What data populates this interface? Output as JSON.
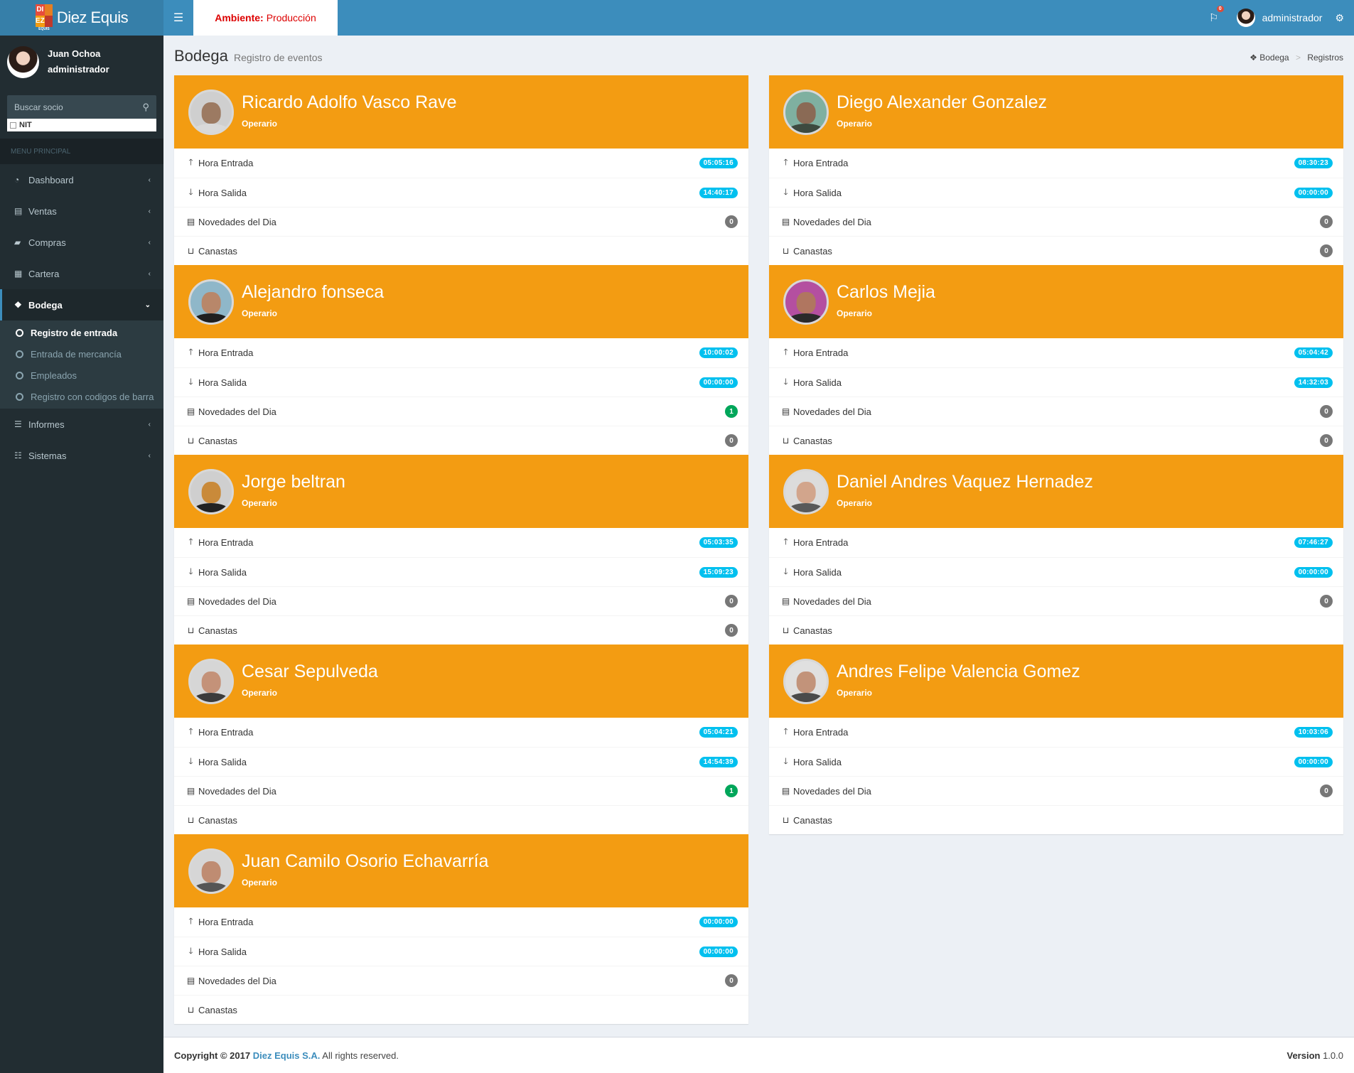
{
  "app": {
    "logo_letters": [
      "DI",
      "EZ"
    ],
    "logo_small": "EQUIS",
    "name": "Diez Equis"
  },
  "header": {
    "environment_label": "Ambiente:",
    "environment_value": "Producción",
    "notifications_count": "0",
    "user": "administrador"
  },
  "sidebar": {
    "user_name": "Juan Ochoa",
    "user_role": "administrador",
    "search_placeholder": "Buscar socio",
    "nit_label": "NIT",
    "menu_header": "MENU PRINCIPAL",
    "items": [
      {
        "label": "Dashboard",
        "icon": "dashboard-icon",
        "glyph": "◔"
      },
      {
        "label": "Ventas",
        "icon": "briefcase-icon",
        "glyph": "▤"
      },
      {
        "label": "Compras",
        "icon": "truck-icon",
        "glyph": "▰"
      },
      {
        "label": "Cartera",
        "icon": "calculator-icon",
        "glyph": "▦"
      },
      {
        "label": "Bodega",
        "icon": "cubes-icon",
        "glyph": "❖"
      },
      {
        "label": "Informes",
        "icon": "list-icon",
        "glyph": "☰"
      },
      {
        "label": "Sistemas",
        "icon": "sliders-icon",
        "glyph": "☷"
      }
    ],
    "submenu": [
      {
        "label": "Registro de entrada"
      },
      {
        "label": "Entrada de mercancía"
      },
      {
        "label": "Empleados"
      },
      {
        "label": "Registro con codigos de barra"
      }
    ]
  },
  "page": {
    "title": "Bodega",
    "subtitle": "Registro de eventos",
    "breadcrumb": [
      "Bodega",
      "Registros"
    ]
  },
  "row_labels": {
    "entrada": "Hora Entrada",
    "salida": "Hora Salida",
    "novedades": "Novedades del Dia",
    "canastas": "Canastas"
  },
  "employees": [
    {
      "name": "Ricardo Adolfo Vasco Rave",
      "role": "Operario",
      "entrada": "05:05:16",
      "salida": "14:40:17",
      "novedades": "0",
      "canastas": "",
      "skin": "#9c7a62",
      "shirt": "#d9d9d9",
      "bg": "#cfcfcf"
    },
    {
      "name": "Diego Alexander Gonzalez",
      "role": "Operario",
      "entrada": "08:30:23",
      "salida": "00:00:00",
      "novedades": "0",
      "canastas": "0",
      "skin": "#8a6a55",
      "shirt": "#3d4a3f",
      "bg": "#7fb0a0"
    },
    {
      "name": "Alejandro fonseca",
      "role": "Operario",
      "entrada": "10:00:02",
      "salida": "00:00:00",
      "novedades": "1",
      "canastas": "0",
      "skin": "#b8876a",
      "shirt": "#1f1f1f",
      "bg": "#8fb7c9"
    },
    {
      "name": "Carlos Mejia",
      "role": "Operario",
      "entrada": "05:04:42",
      "salida": "14:32:03",
      "novedades": "0",
      "canastas": "0",
      "skin": "#b07660",
      "shirt": "#2a2a2a",
      "bg": "#b44fa0"
    },
    {
      "name": "Jorge beltran",
      "role": "Operario",
      "entrada": "05:03:35",
      "salida": "15:09:23",
      "novedades": "0",
      "canastas": "0",
      "skin": "#c98a3a",
      "shirt": "#222222",
      "bg": "#cfcfcf"
    },
    {
      "name": "Daniel Andres Vaquez Hernadez",
      "role": "Operario",
      "entrada": "07:46:27",
      "salida": "00:00:00",
      "novedades": "0",
      "canastas": "",
      "skin": "#d2a58c",
      "shirt": "#595959",
      "bg": "#dcdcdc"
    },
    {
      "name": "Cesar Sepulveda",
      "role": "Operario",
      "entrada": "05:04:21",
      "salida": "14:54:39",
      "novedades": "1",
      "canastas": "",
      "skin": "#c49279",
      "shirt": "#3b3b3b",
      "bg": "#d6d6d6"
    },
    {
      "name": "Andres Felipe Valencia Gomez",
      "role": "Operario",
      "entrada": "10:03:06",
      "salida": "00:00:00",
      "novedades": "0",
      "canastas": "",
      "skin": "#c2937a",
      "shirt": "#4a4a4a",
      "bg": "#e0e0e0"
    },
    {
      "name": "Juan Camilo Osorio Echavarría",
      "role": "Operario",
      "entrada": "00:00:00",
      "salida": "00:00:00",
      "novedades": "0",
      "canastas": "",
      "skin": "#bf8c72",
      "shirt": "#555555",
      "bg": "#d6d6d6"
    }
  ],
  "footer": {
    "copyright_prefix": "Copyright © 2017",
    "company": "Diez Equis S.A.",
    "rights": "All rights reserved.",
    "version_label": "Version",
    "version_value": "1.0.0"
  },
  "colors": {
    "header": "#3c8dbc",
    "logo_bar": "#367fa9",
    "sidebar": "#222d32",
    "card_header": "#f39c12",
    "time_badge": "#00c0ef",
    "count_badge": "#777777",
    "count_badge_positive": "#00a65a"
  }
}
